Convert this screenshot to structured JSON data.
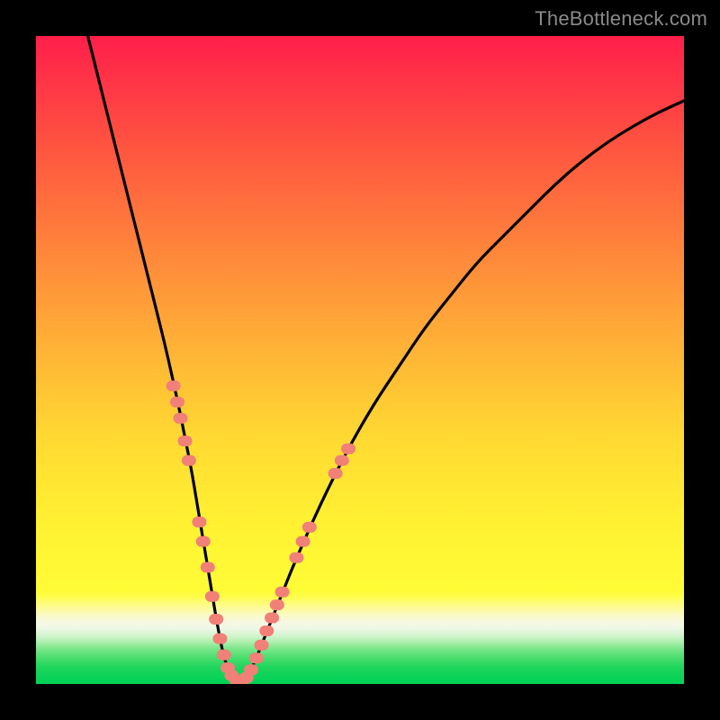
{
  "watermark": "TheBottleneck.com",
  "chart_data": {
    "type": "line",
    "title": "",
    "xlabel": "",
    "ylabel": "",
    "xlim": [
      0,
      100
    ],
    "ylim": [
      0,
      100
    ],
    "grid": false,
    "legend": false,
    "series": [
      {
        "name": "bottleneck-curve",
        "x": [
          8,
          10,
          12,
          14,
          16,
          18,
          20,
          22,
          23,
          24,
          25,
          26,
          27,
          28,
          29,
          30,
          31,
          32,
          33,
          34,
          36,
          38,
          40,
          44,
          48,
          52,
          56,
          60,
          64,
          68,
          72,
          76,
          80,
          84,
          88,
          92,
          96,
          100
        ],
        "values": [
          100,
          92,
          84,
          76,
          68,
          60,
          52,
          43,
          38,
          33,
          27,
          21,
          15,
          9,
          4,
          1.5,
          0.3,
          0.4,
          1.8,
          4,
          9,
          14,
          19,
          28,
          36,
          43,
          49,
          55,
          60,
          65,
          69,
          73,
          77,
          80.5,
          83.5,
          86,
          88.2,
          90
        ]
      }
    ],
    "scatter": {
      "name": "highlight-dots",
      "color": "#f08078",
      "points": [
        {
          "x": 21.2,
          "y": 46.0
        },
        {
          "x": 21.8,
          "y": 43.5
        },
        {
          "x": 22.3,
          "y": 41.0
        },
        {
          "x": 23.0,
          "y": 37.5
        },
        {
          "x": 23.6,
          "y": 34.5
        },
        {
          "x": 25.2,
          "y": 25.0
        },
        {
          "x": 25.8,
          "y": 22.0
        },
        {
          "x": 26.5,
          "y": 18.0
        },
        {
          "x": 27.2,
          "y": 13.5
        },
        {
          "x": 27.8,
          "y": 10.0
        },
        {
          "x": 28.4,
          "y": 7.0
        },
        {
          "x": 29.0,
          "y": 4.5
        },
        {
          "x": 29.6,
          "y": 2.5
        },
        {
          "x": 30.2,
          "y": 1.3
        },
        {
          "x": 31.0,
          "y": 0.4
        },
        {
          "x": 31.8,
          "y": 0.5
        },
        {
          "x": 32.5,
          "y": 1.0
        },
        {
          "x": 33.2,
          "y": 2.2
        },
        {
          "x": 34.0,
          "y": 4.0
        },
        {
          "x": 34.8,
          "y": 6.0
        },
        {
          "x": 35.6,
          "y": 8.2
        },
        {
          "x": 36.4,
          "y": 10.2
        },
        {
          "x": 37.2,
          "y": 12.2
        },
        {
          "x": 38.0,
          "y": 14.2
        },
        {
          "x": 40.2,
          "y": 19.5
        },
        {
          "x": 41.2,
          "y": 22.0
        },
        {
          "x": 42.2,
          "y": 24.2
        },
        {
          "x": 46.2,
          "y": 32.5
        },
        {
          "x": 47.2,
          "y": 34.5
        },
        {
          "x": 48.2,
          "y": 36.3
        }
      ]
    },
    "annotations": []
  },
  "colors": {
    "curve": "#000000",
    "dots": "#f08078",
    "background_top": "#ff1f4a",
    "background_bottom": "#00d056",
    "frame": "#000000",
    "watermark": "#8a8a8a"
  }
}
